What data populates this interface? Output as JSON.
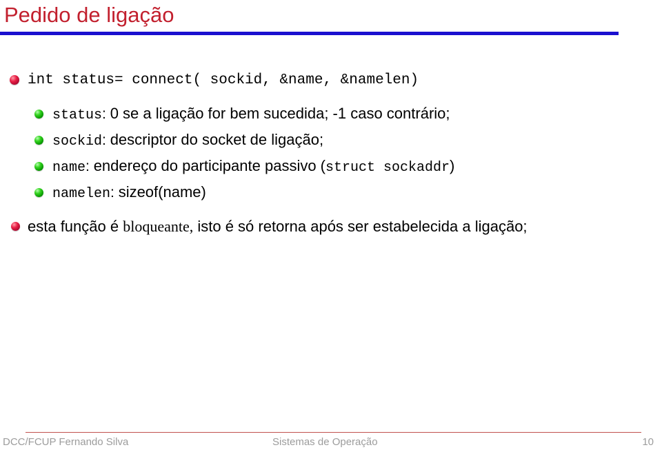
{
  "slide": {
    "title": "Pedido de ligação",
    "title_color": "#C2202E",
    "rule_color": "#1A10CF",
    "background": "#FFFFFF"
  },
  "content": {
    "code_line": {
      "bullet": "red-sphere-bullet",
      "text": "int status= connect( sockid, &name, &namelen)"
    },
    "params": [
      {
        "bullet": "green-sphere-bullet",
        "name": "status",
        "separator": ": ",
        "description": "0 se a ligação for bem sucedida; -1 caso contrário;",
        "suffix": ""
      },
      {
        "bullet": "green-sphere-bullet",
        "name": "sockid",
        "separator": ": ",
        "description": "descriptor do socket de ligação;",
        "suffix": ""
      },
      {
        "bullet": "green-sphere-bullet",
        "name": "name",
        "separator": ": ",
        "description": "endereço do participante passivo (",
        "suffix": "struct sockaddr",
        "suffix_close": ")"
      },
      {
        "bullet": "green-sphere-bullet",
        "name": "namelen",
        "separator": ": ",
        "description": "sizeof(name)",
        "suffix": ""
      }
    ],
    "note": {
      "bullet": "red-sphere-bullet",
      "part1": "esta função é ",
      "emphasis": "bloqueante,",
      "part2": " isto é só retorna após ser estabelecida a ligação;"
    }
  },
  "footer": {
    "left": "DCC/FCUP Fernando Silva",
    "center": "Sistemas de Operação",
    "page_number": "10",
    "rule_color": "#C0504D",
    "text_color": "#9C9C9C"
  }
}
